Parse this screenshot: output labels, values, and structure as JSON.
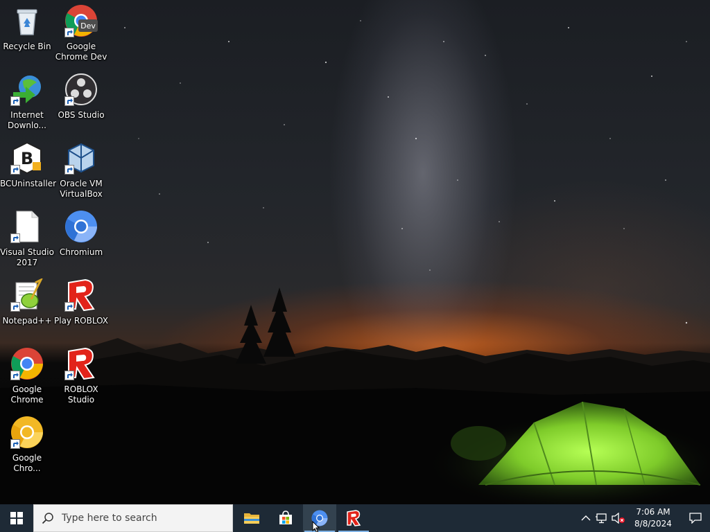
{
  "desktop": {
    "icons": [
      {
        "label": "Recycle Bin",
        "icon": "recycle-bin-icon"
      },
      {
        "label": "Google\nChrome Dev",
        "icon": "chrome-dev-icon"
      },
      {
        "label": "Internet\nDownlo...",
        "icon": "internet-download-manager-icon"
      },
      {
        "label": "OBS Studio",
        "icon": "obs-studio-icon"
      },
      {
        "label": "BCUninstaller",
        "icon": "bcuninstaller-icon"
      },
      {
        "label": "Oracle VM\nVirtualBox",
        "icon": "virtualbox-icon"
      },
      {
        "label": "Visual Studio\n2017",
        "icon": "blank-file-icon"
      },
      {
        "label": "Chromium",
        "icon": "chromium-icon"
      },
      {
        "label": "Notepad++",
        "icon": "notepad-plus-plus-icon"
      },
      {
        "label": "Play ROBLOX",
        "icon": "roblox-icon"
      },
      {
        "label": "Google\nChrome",
        "icon": "chrome-icon"
      },
      {
        "label": "ROBLOX\nStudio",
        "icon": "roblox-studio-icon"
      },
      {
        "label": "Google\nChro...",
        "icon": "chrome-canary-icon"
      }
    ],
    "chrome_dev_badge": "Dev"
  },
  "taskbar": {
    "search_placeholder": "Type here to search",
    "pinned": [
      {
        "name": "file-explorer",
        "icon": "folder-icon"
      },
      {
        "name": "microsoft-store",
        "icon": "store-icon"
      },
      {
        "name": "chromium",
        "icon": "chromium-icon",
        "active": true
      },
      {
        "name": "roblox",
        "icon": "roblox-icon",
        "running": true
      }
    ],
    "tray": {
      "time": "7:06 AM",
      "date": "8/8/2024"
    }
  },
  "colors": {
    "taskbar_bg": "#1e2a36",
    "search_bg": "#f3f3f3",
    "accent": "#7fb2e5",
    "tent_green": "#8de03a"
  }
}
